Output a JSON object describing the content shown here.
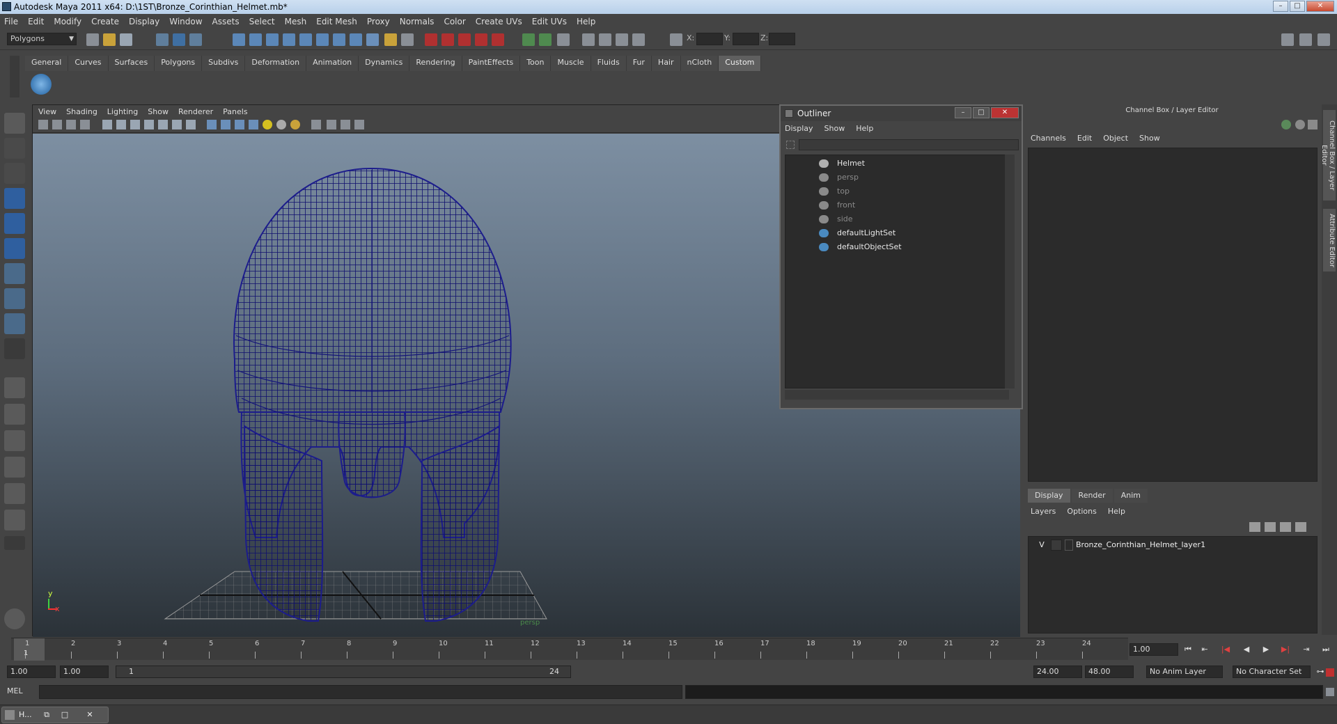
{
  "window": {
    "title": "Autodesk Maya 2011 x64: D:\\1ST\\Bronze_Corinthian_Helmet.mb*"
  },
  "menubar": [
    "File",
    "Edit",
    "Modify",
    "Create",
    "Display",
    "Window",
    "Assets",
    "Select",
    "Mesh",
    "Edit Mesh",
    "Proxy",
    "Normals",
    "Color",
    "Create UVs",
    "Edit UVs",
    "Help"
  ],
  "status": {
    "mode": "Polygons",
    "x_label": "X:",
    "y_label": "Y:",
    "z_label": "Z:"
  },
  "shelf_tabs": [
    "General",
    "Curves",
    "Surfaces",
    "Polygons",
    "Subdivs",
    "Deformation",
    "Animation",
    "Dynamics",
    "Rendering",
    "PaintEffects",
    "Toon",
    "Muscle",
    "Fluids",
    "Fur",
    "Hair",
    "nCloth",
    "Custom"
  ],
  "shelf_active": "Custom",
  "viewport": {
    "menu": [
      "View",
      "Shading",
      "Lighting",
      "Show",
      "Renderer",
      "Panels"
    ],
    "camera_label": "persp",
    "axis_y": "y",
    "axis_x": "x",
    "wire_color": "#1c1c8c"
  },
  "outliner": {
    "title": "Outliner",
    "menu": [
      "Display",
      "Show",
      "Help"
    ],
    "items": [
      {
        "label": "Helmet",
        "color": "#e6e6e6",
        "icon": "mesh-icon"
      },
      {
        "label": "persp",
        "color": "#8a8a8a",
        "icon": "camera-icon"
      },
      {
        "label": "top",
        "color": "#8a8a8a",
        "icon": "camera-icon"
      },
      {
        "label": "front",
        "color": "#8a8a8a",
        "icon": "camera-icon"
      },
      {
        "label": "side",
        "color": "#8a8a8a",
        "icon": "camera-icon"
      },
      {
        "label": "defaultLightSet",
        "color": "#e6e6e6",
        "icon": "set-icon"
      },
      {
        "label": "defaultObjectSet",
        "color": "#e6e6e6",
        "icon": "set-icon"
      }
    ]
  },
  "channel_box": {
    "title": "Channel Box / Layer Editor",
    "menu": [
      "Channels",
      "Edit",
      "Object",
      "Show"
    ],
    "layer_tabs": [
      "Display",
      "Render",
      "Anim"
    ],
    "layer_menu": [
      "Layers",
      "Options",
      "Help"
    ],
    "layer": {
      "visible": "V",
      "name": "Bronze_Corinthian_Helmet_layer1"
    }
  },
  "side_tabs": [
    "Channel Box / Layer Editor",
    "Attribute Editor"
  ],
  "time_slider": {
    "ticks": [
      "1",
      "2",
      "3",
      "4",
      "5",
      "6",
      "7",
      "8",
      "9",
      "10",
      "11",
      "12",
      "13",
      "14",
      "15",
      "16",
      "17",
      "18",
      "19",
      "20",
      "21",
      "22",
      "23",
      "24"
    ],
    "current_frame": "1.00",
    "current_marker": "1"
  },
  "range_slider": {
    "start": "1.00",
    "anim_start": "1.00",
    "bar_start": "1",
    "bar_end": "24",
    "anim_end": "24.00",
    "end": "48.00",
    "anim_layer": "No Anim Layer",
    "character_set": "No Character Set"
  },
  "command_line": {
    "label": "MEL"
  },
  "taskbar": {
    "label": "H..."
  }
}
